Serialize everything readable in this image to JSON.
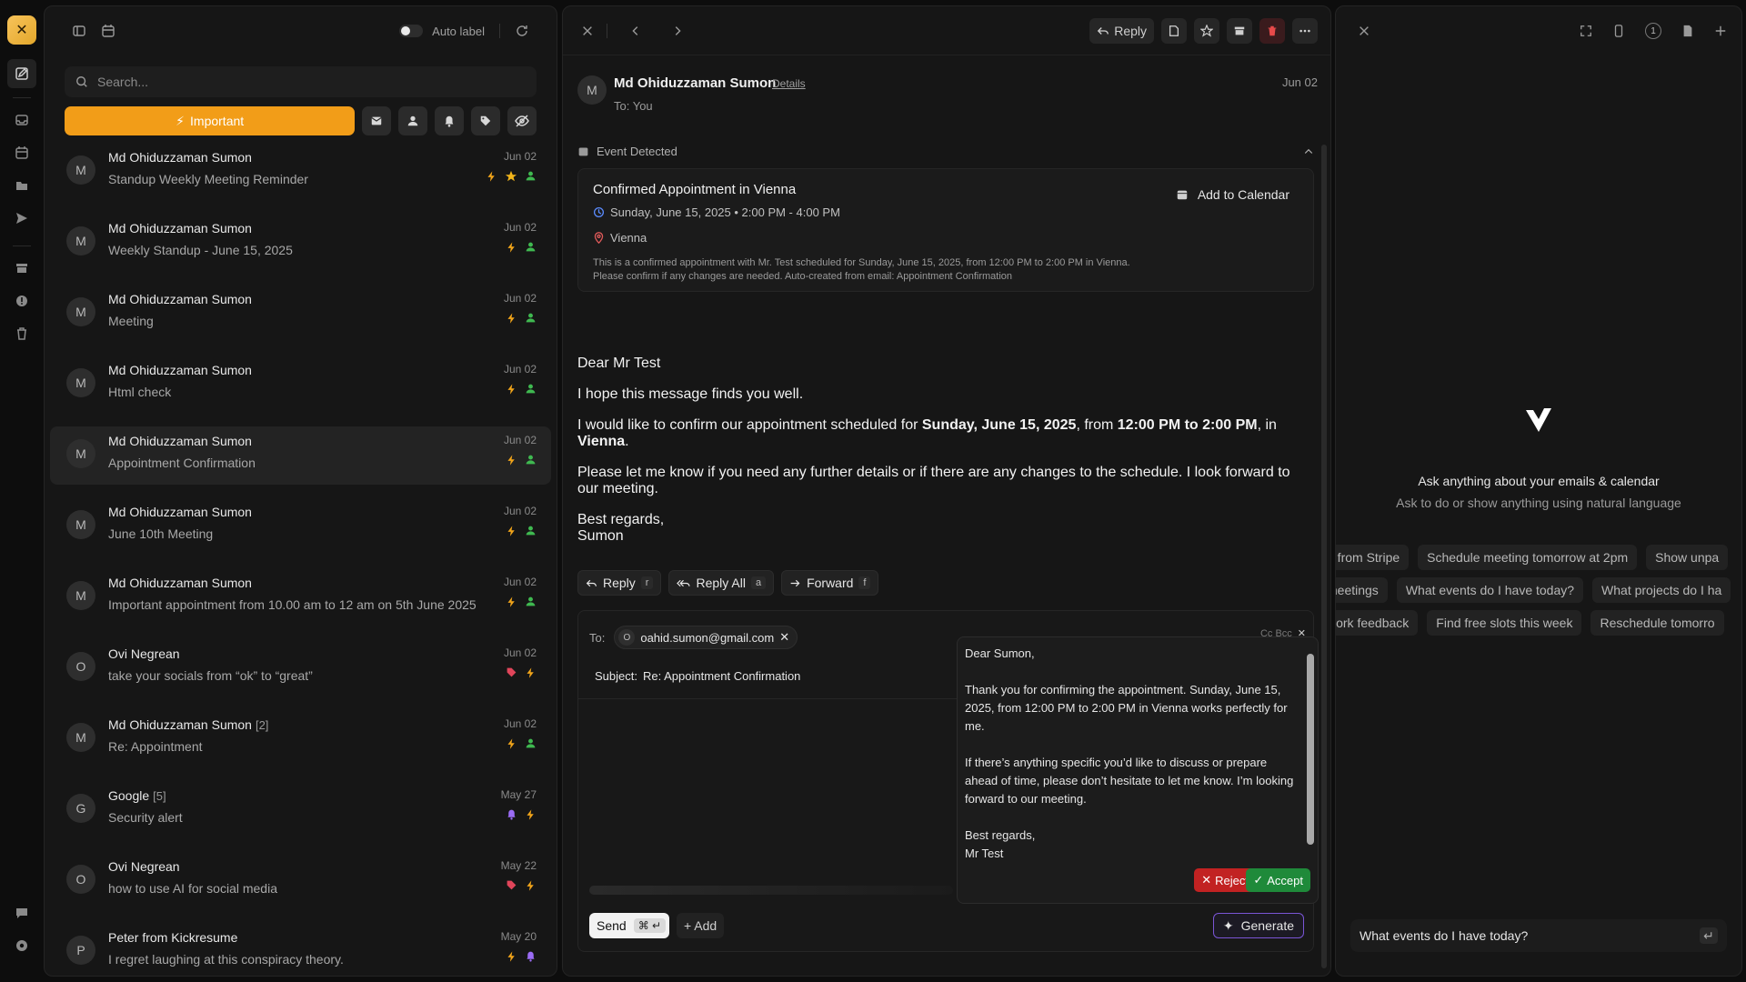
{
  "rail": {
    "logo_icon": "app-logo-icon",
    "items": [
      "compose-icon",
      "inbox-icon",
      "calendar-icon",
      "folder-icon",
      "send-icon",
      "archive-icon",
      "spam-icon",
      "trash-icon"
    ],
    "bottom": [
      "feedback-icon",
      "settings-icon"
    ]
  },
  "list": {
    "auto_label": "Auto label",
    "search_placeholder": "Search...",
    "important_label": "Important",
    "items": [
      {
        "avatar": "M",
        "from": "Md Ohiduzzaman Sumon",
        "count": "",
        "subject": "Standup Weekly Meeting Reminder",
        "date": "Jun 02",
        "tags": [
          "bolt",
          "star",
          "person"
        ]
      },
      {
        "avatar": "M",
        "from": "Md Ohiduzzaman Sumon",
        "count": "",
        "subject": "Weekly Standup - June 15, 2025",
        "date": "Jun 02",
        "tags": [
          "bolt",
          "person"
        ]
      },
      {
        "avatar": "M",
        "from": "Md Ohiduzzaman Sumon",
        "count": "",
        "subject": "Meeting",
        "date": "Jun 02",
        "tags": [
          "bolt",
          "person"
        ]
      },
      {
        "avatar": "M",
        "from": "Md Ohiduzzaman Sumon",
        "count": "",
        "subject": "Html check",
        "date": "Jun 02",
        "tags": [
          "bolt",
          "person"
        ]
      },
      {
        "avatar": "M",
        "from": "Md Ohiduzzaman Sumon",
        "count": "",
        "subject": "Appointment Confirmation",
        "date": "Jun 02",
        "tags": [
          "bolt",
          "person"
        ],
        "selected": true
      },
      {
        "avatar": "M",
        "from": "Md Ohiduzzaman Sumon",
        "count": "",
        "subject": "June 10th Meeting",
        "date": "Jun 02",
        "tags": [
          "bolt",
          "person"
        ]
      },
      {
        "avatar": "M",
        "from": "Md Ohiduzzaman Sumon",
        "count": "",
        "subject": "Important appointment from 10.00 am to 12 am on 5th June 2025",
        "date": "Jun 02",
        "tags": [
          "bolt",
          "person"
        ]
      },
      {
        "avatar": "O",
        "from": "Ovi Negrean",
        "count": "",
        "subject": "take your socials from “ok” to “great”",
        "date": "Jun 02",
        "tags": [
          "tag",
          "bolt"
        ]
      },
      {
        "avatar": "M",
        "from": "Md Ohiduzzaman Sumon",
        "count": "[2]",
        "subject": "Re: Appointment",
        "date": "Jun 02",
        "tags": [
          "bolt",
          "person"
        ]
      },
      {
        "avatar": "G",
        "from": "Google",
        "count": "[5]",
        "subject": "Security alert",
        "date": "May 27",
        "tags": [
          "bell",
          "bolt"
        ]
      },
      {
        "avatar": "O",
        "from": "Ovi Negrean",
        "count": "",
        "subject": "how to use AI for social media",
        "date": "May 22",
        "tags": [
          "tag",
          "bolt"
        ]
      },
      {
        "avatar": "P",
        "from": "Peter from Kickresume",
        "count": "",
        "subject": "I regret laughing at this conspiracy theory.",
        "date": "May 20",
        "tags": [
          "bolt",
          "bell"
        ]
      }
    ]
  },
  "mail": {
    "reply_label": "Reply",
    "sender": {
      "avatar": "M",
      "name": "Md Ohiduzzaman Sumon",
      "details": "Details",
      "to": "To: You",
      "date": "Jun 02"
    },
    "event": {
      "section_label": "Event Detected",
      "title": "Confirmed Appointment in Vienna",
      "time": "Sunday, June 15, 2025 • 2:00 PM - 4:00 PM",
      "location": "Vienna",
      "description": "This is a confirmed appointment with Mr. Test scheduled for Sunday, June 15, 2025, from 12:00 PM to 2:00 PM in Vienna. Please confirm if any changes are needed. Auto-created from email: Appointment Confirmation",
      "add_label": "Add to Calendar"
    },
    "body": {
      "greeting": "Dear Mr Test",
      "p1": "I hope this message finds you well.",
      "p2_a": "I would like to confirm our appointment scheduled for ",
      "p2_date": "Sunday, June 15, 2025",
      "p2_b": ", from ",
      "p2_time": "12:00 PM to 2:00 PM",
      "p2_c": ", in ",
      "p2_place": "Vienna",
      "p2_d": ".",
      "p3": "Please let me know if you need any further details or if there are any changes to the schedule. I look forward to our meeting.",
      "sign1": "Best regards,",
      "sign2": "Sumon"
    },
    "actions": [
      {
        "label": "Reply",
        "key": "r"
      },
      {
        "label": "Reply All",
        "key": "a"
      },
      {
        "label": "Forward",
        "key": "f"
      }
    ],
    "compose": {
      "to_label": "To:",
      "to_avatar": "O",
      "to_email": "oahid.sumon@gmail.com",
      "cc_bcc": "Cc  Bcc",
      "subject_label": "Subject:",
      "subject": "Re: Appointment Confirmation",
      "send": "Send",
      "send_key": "⌘ ↵",
      "add": "+ Add",
      "generate": "Generate"
    },
    "suggestion": {
      "text": "Dear Sumon,\n\nThank you for confirming the appointment. Sunday, June 15, 2025, from 12:00 PM to 2:00 PM in Vienna works perfectly for me.\n\nIf there’s anything specific you’d like to discuss or prepare ahead of time, please don’t hesitate to let me know. I’m looking forward to our meeting.\n\nBest regards,\nMr Test",
      "reject": "Reject",
      "accept": "Accept"
    }
  },
  "ai": {
    "badge": "1",
    "heading": "Ask anything about your emails & calendar",
    "sub": "Ask to do or show anything using natural language",
    "pills_row1": [
      "e from Stripe",
      "Schedule meeting tomorrow at 2pm",
      "Show unpa"
    ],
    "pills_row2": [
      "meetings",
      "What events do I have today?",
      "What projects do I ha"
    ],
    "pills_row3": [
      "work feedback",
      "Find free slots this week",
      "Reschedule tomorro"
    ],
    "input_value": "What events do I have today?"
  },
  "colors": {
    "accent_orange": "#f29d18",
    "danger": "#c22222",
    "success": "#1f8a3a",
    "generate_border": "#7a55d6"
  }
}
